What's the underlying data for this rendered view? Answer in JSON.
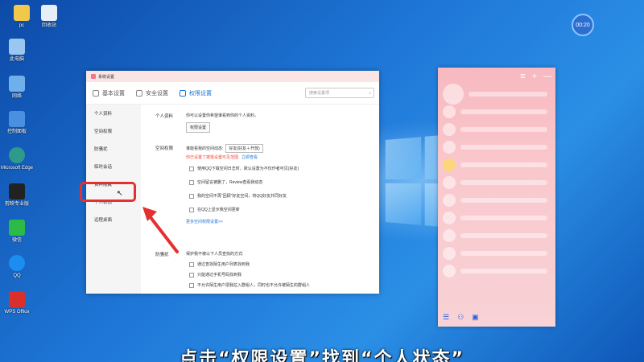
{
  "desktop": {
    "timer": "00:20",
    "icons": [
      {
        "label": "pc",
        "color": "#f2c84b"
      },
      {
        "label": "回收站",
        "color": "#e6eef7"
      },
      {
        "label": "此电脑",
        "color": "#9ac7f2"
      },
      {
        "label": "网络",
        "color": "#6fb0ea"
      },
      {
        "label": "控制面板",
        "color": "#4b90e0"
      },
      {
        "label": "Microsoft Edge",
        "color": "#2e9a8c"
      },
      {
        "label": "剪映专业版",
        "color": "#222222"
      },
      {
        "label": "微信",
        "color": "#2dbb47"
      },
      {
        "label": "QQ",
        "color": "#1c8ef0"
      },
      {
        "label": "WPS Office",
        "color": "#d9302b"
      }
    ]
  },
  "settings_window": {
    "title": "系统设置",
    "tabs": [
      "基本设置",
      "安全设置",
      "权限设置"
    ],
    "search_placeholder": "搜索设置项",
    "sidebar": [
      "个人资料",
      "空间权限",
      "防骚扰",
      "临时会话",
      "资料隐藏",
      "个人状态",
      "远程桌面"
    ],
    "sections": {
      "profile_label": "个人资料",
      "profile_desc": "你可以设置你希望谁看到你的个人资料。",
      "profile_button": "权限设置",
      "space_label": "空间权限",
      "space_desc": "谁能看我的空间动态:",
      "space_select": "好友(好友＋开放)",
      "space_warning": "你已设置了按需设置可见范围",
      "space_link": "立即查看",
      "space_options": [
        "使用QQ下载空间日志时，默认设置为不仅作者可见(好友)",
        "空间留言被删了，Review查看我动态",
        "我的空间不再“回顾”好友空间，将QQ好友共同好友",
        "在QQ上显示我空间更新"
      ],
      "space_more": "更多空间权限设置>>",
      "harass_label": "防骚扰",
      "harass_desc": "保护我不被以下人员查找的方式:",
      "harass_options": [
        "通过查找陌生用户列表找到我",
        "只能通过手机号码找到我",
        "不允许陌生用户把我拉入群组人，同时也不允许被陌生的群组人"
      ]
    }
  },
  "subtitle": "点击“权限设置”找到“个人状态”"
}
